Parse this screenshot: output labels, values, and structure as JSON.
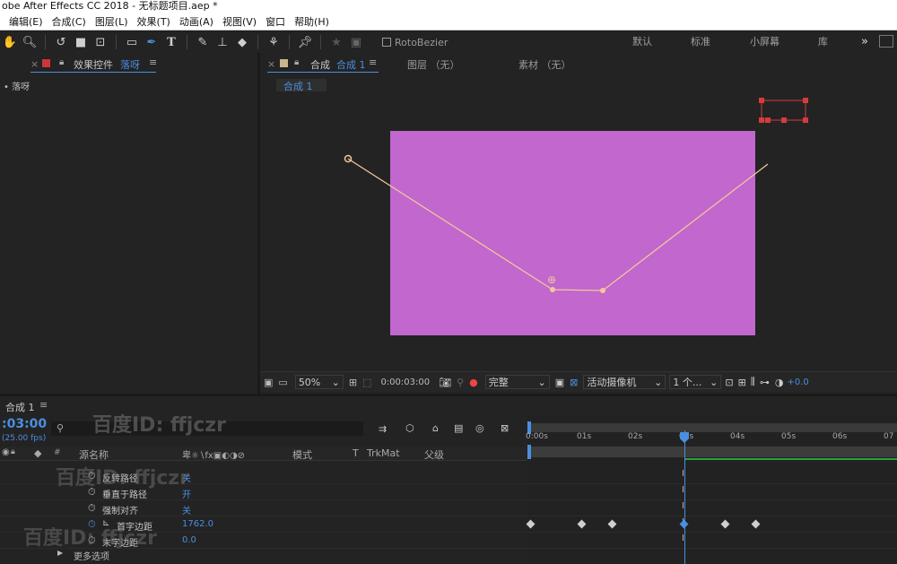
{
  "app": {
    "title": "obe After Effects CC 2018 - 无标题项目.aep *"
  },
  "menu": [
    "编辑(E)",
    "合成(C)",
    "图层(L)",
    "效果(T)",
    "动画(A)",
    "视图(V)",
    "窗口",
    "帮助(H)"
  ],
  "toolbar": {
    "rotobezier_label": "RotoBezier",
    "workspaces": [
      "默认",
      "标准",
      "小屏幕",
      "库"
    ],
    "more": "»"
  },
  "effects_panel": {
    "tab_prefix": "效果控件",
    "tab_layer": "落呀",
    "layer_item": "• 落呀"
  },
  "comp_panel": {
    "tab_prefix": "合成",
    "tab_name": "合成 1",
    "layer_tab": "图层 （无）",
    "footage_tab": "素材 （无）",
    "flow_button": "合成 1",
    "zoom": "50%",
    "timecode": "0:00:03:00",
    "resolution": "完整",
    "camera": "活动摄像机",
    "views": "1 个...",
    "exposure": "+0.0",
    "solid_color": "#c167cd",
    "path_color": "#f2c79a"
  },
  "timeline": {
    "tab": "合成 1",
    "current_time": ":03:00",
    "fps": "(25.00 fps)",
    "search_placeholder": "",
    "col_name": "源名称",
    "col_mode": "模式",
    "col_t": "T",
    "col_trkmat": "TrkMat",
    "col_parent": "父级",
    "props": [
      {
        "name": "反转路径",
        "value": "关"
      },
      {
        "name": "垂直于路径",
        "value": "开"
      },
      {
        "name": "强制对齐",
        "value": "关"
      },
      {
        "name": "首字边距",
        "value": "1762.0"
      },
      {
        "name": "末字边距",
        "value": "0.0"
      }
    ],
    "more_options": "更多选项",
    "ruler": [
      "0:00s",
      "01s",
      "02s",
      "03s",
      "04s",
      "05s",
      "06s",
      "07"
    ],
    "playhead_time_s": 3,
    "keyframes_s": [
      0,
      1,
      1.6,
      3,
      3.8,
      4.4
    ],
    "workarea_color": "#2d9f3e"
  },
  "watermark": "百度ID: ffjczr"
}
